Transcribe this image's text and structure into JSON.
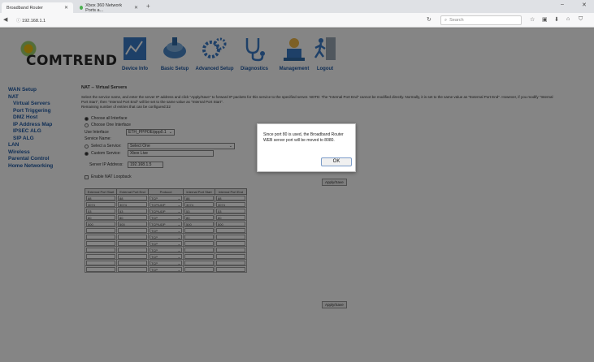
{
  "browser": {
    "tabs": [
      {
        "title": "Broadband Router",
        "close": "✕"
      },
      {
        "title": "Xbox 360 Network Ports a...",
        "close": "✕"
      }
    ],
    "new_tab": "+",
    "url": "192.168.1.1",
    "search_placeholder": "Search",
    "window_min": "–",
    "window_close": "✕"
  },
  "header": {
    "brand": "COMTREND",
    "menu": [
      {
        "label": "Device Info",
        "icon": "device-info-icon"
      },
      {
        "label": "Basic Setup",
        "icon": "basic-setup-icon"
      },
      {
        "label": "Advanced Setup",
        "icon": "gears-icon"
      },
      {
        "label": "Diagnostics",
        "icon": "stethoscope-icon"
      },
      {
        "label": "Management",
        "icon": "management-icon"
      },
      {
        "label": "Logout",
        "icon": "logout-icon"
      }
    ]
  },
  "sidebar": {
    "items": [
      {
        "label": "WAN Setup",
        "sub": false
      },
      {
        "label": "NAT",
        "sub": false
      },
      {
        "label": "Virtual Servers",
        "sub": true
      },
      {
        "label": "Port Triggering",
        "sub": true
      },
      {
        "label": "DMZ Host",
        "sub": true
      },
      {
        "label": "IP Address Map",
        "sub": true
      },
      {
        "label": "IPSEC ALG",
        "sub": true
      },
      {
        "label": "SIP ALG",
        "sub": true
      },
      {
        "label": "LAN",
        "sub": false
      },
      {
        "label": "Wireless",
        "sub": false
      },
      {
        "label": "Parental Control",
        "sub": false
      },
      {
        "label": "Home Networking",
        "sub": false
      }
    ]
  },
  "main": {
    "title": "NAT -- Virtual Servers",
    "description_line1": "Select the service name, and enter the server IP address and click \"Apply/Save\" to forward IP packets for this service to the specified server. NOTE: The \"Internal Port End\" cannot be modified directly. Normally, it is set to the same value as \"External Port End\". However, if you modify \"Internal",
    "description_line2": "Port Start\", then \"Internal Port End\" will be set to the same value as \"Internal Port Start\".",
    "description_line3": "Remaining number of entries that can be configured:32",
    "use_interface_label": "Use Interface",
    "choose_all": "Choose all Interface",
    "choose_one": "Choose One Interface",
    "interface_value": "ETH_PPPOE/ppp0.1",
    "service_name_label": "Service Name:",
    "select_service_label": "Select a Service:",
    "select_service_value": "Select One",
    "custom_service_label": "Custom Service:",
    "custom_service_value": "Xbox Live",
    "server_ip_label": "Server IP Address:",
    "server_ip_value": "192.168.1.5",
    "nat_loopback_label": "Enable NAT Loopback",
    "apply_save": "Apply/Save",
    "table": {
      "headers": [
        "External Port Start",
        "External Port End",
        "Protocol",
        "Internal Port Start",
        "Internal Port End"
      ],
      "rows": [
        [
          "88",
          "88",
          "TCP",
          "88",
          "88"
        ],
        [
          "3074",
          "3074",
          "TCP/UDP",
          "3074",
          "3074"
        ],
        [
          "53",
          "53",
          "TCP/UDP",
          "53",
          "53"
        ],
        [
          "80",
          "80",
          "TCP",
          "80",
          "80"
        ],
        [
          "500",
          "500",
          "TCP/UDP",
          "500",
          "500"
        ],
        [
          "",
          "",
          "TCP",
          "",
          ""
        ],
        [
          "",
          "",
          "TCP",
          "",
          ""
        ],
        [
          "",
          "",
          "TCP",
          "",
          ""
        ],
        [
          "",
          "",
          "TCP",
          "",
          ""
        ],
        [
          "",
          "",
          "TCP",
          "",
          ""
        ],
        [
          "",
          "",
          "TCP",
          "",
          ""
        ],
        [
          "",
          "",
          "TCP",
          "",
          ""
        ]
      ]
    }
  },
  "modal": {
    "message": "Since port 80 is used, the Broadband Router WEB server port will be moved to 8080.",
    "ok": "OK"
  }
}
